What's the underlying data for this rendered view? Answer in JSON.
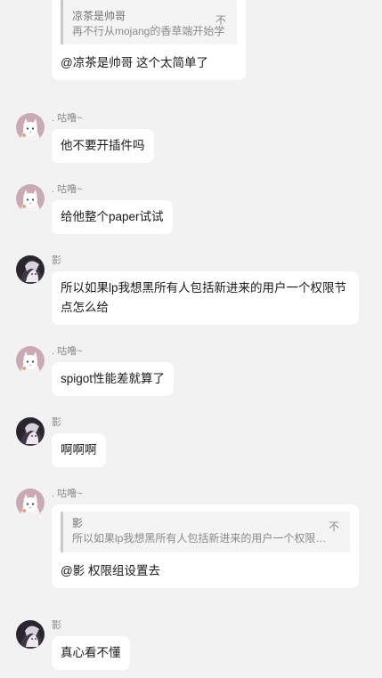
{
  "messages": [
    {
      "reply": {
        "author": "凉茶是帅哥",
        "text": "再不行从mojang的香草端开始学",
        "mark": "不"
      },
      "text": "@凉茶是帅哥 这个太简单了"
    },
    {
      "sender": ". 咕噜~",
      "avatar": "cat-avatar-icon",
      "text": "他不要开插件吗"
    },
    {
      "sender": ". 咕噜~",
      "avatar": "cat-avatar-icon",
      "text": "给他整个paper试试"
    },
    {
      "sender": "影",
      "avatar": "anime-character-avatar-icon",
      "text": "所以如果lp我想黑所有人包括新进来的用户一个权限节点怎么给"
    },
    {
      "sender": ". 咕噜~",
      "avatar": "cat-avatar-icon",
      "text": "spigot性能差就算了"
    },
    {
      "sender": "影",
      "avatar": "anime-character-avatar-icon",
      "text": "啊啊啊"
    },
    {
      "sender": ". 咕噜~",
      "avatar": "cat-avatar-icon",
      "reply": {
        "author": "影",
        "text": "所以如果lp我想黑所有人包括新进来的用户一个权限节...",
        "mark": "不"
      },
      "text": "@影 权限组设置去"
    },
    {
      "sender": "影",
      "avatar": "anime-character-avatar-icon",
      "text": "真心看不懂"
    }
  ]
}
